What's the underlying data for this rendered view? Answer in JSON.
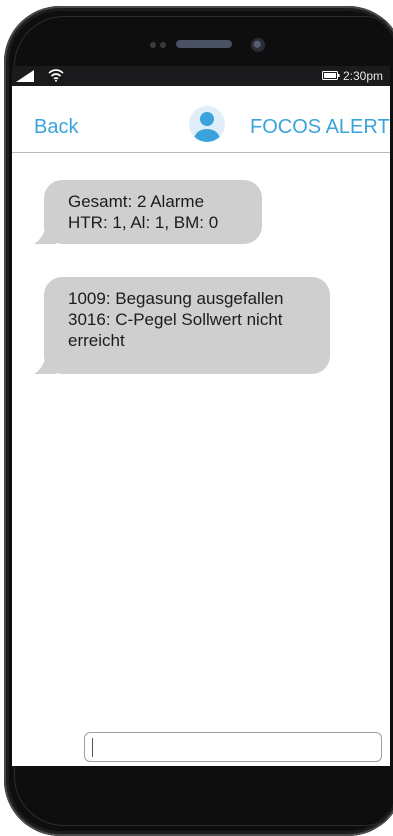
{
  "status_bar": {
    "time": "2:30pm",
    "signal_icon": "signal-icon",
    "wifi_icon": "wifi-icon",
    "battery_icon": "battery-icon"
  },
  "nav": {
    "back_label": "Back",
    "contact_name": "FOCOS ALERT",
    "avatar_icon": "person-avatar-icon"
  },
  "messages": [
    {
      "lines": [
        "Gesamt: 2 Alarme",
        "HTR: 1, Al: 1, BM: 0"
      ]
    },
    {
      "lines": [
        "1009: Begasung ausgefallen",
        "3016: C-Pegel Sollwert nicht",
        "erreicht"
      ]
    }
  ],
  "composer": {
    "value": ""
  },
  "colors": {
    "accent": "#3aa3dc",
    "bubble": "#cfcfcf",
    "status_bar": "#1b1b1d",
    "phone_body": "#0e0e0f"
  }
}
